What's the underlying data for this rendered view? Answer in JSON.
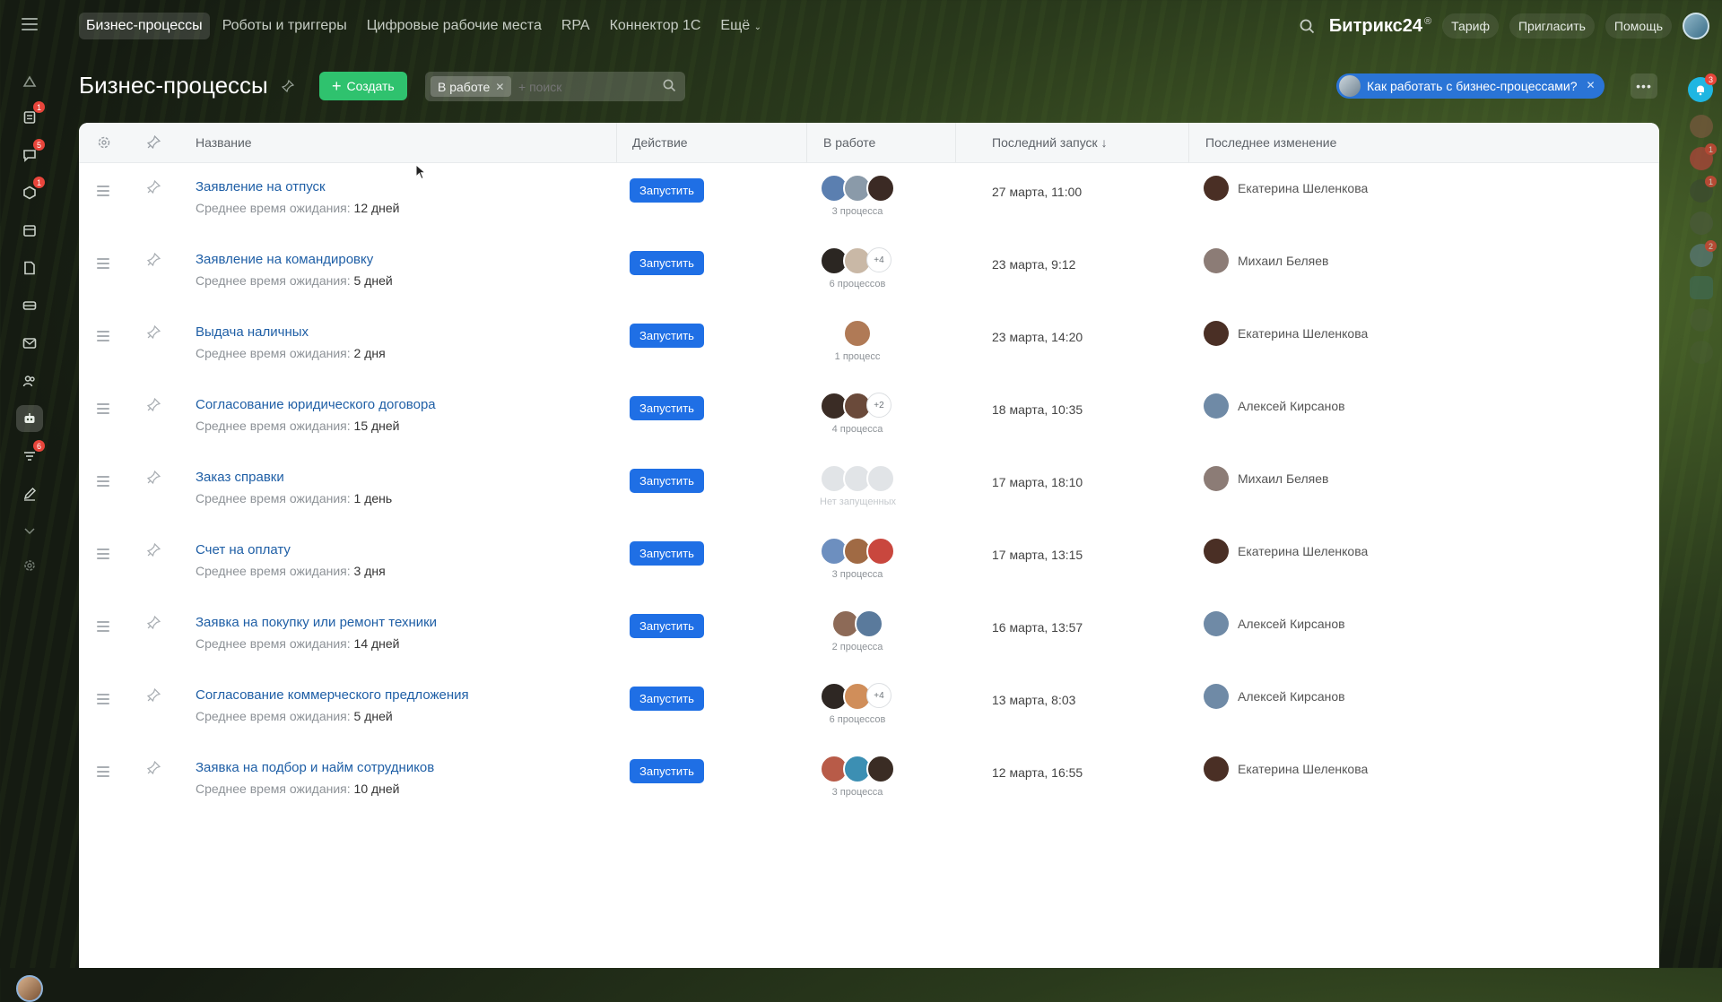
{
  "topnav": {
    "items": [
      "Бизнес-процессы",
      "Роботы и триггеры",
      "Цифровые рабочие места",
      "RPA",
      "Коннектор 1С",
      "Ещё"
    ],
    "brand": "Битрикс24",
    "brand_mark": "®",
    "tariff": "Тариф",
    "invite": "Пригласить",
    "help": "Помощь"
  },
  "leftbar": {
    "badges": [
      "1",
      "5",
      "1",
      "6"
    ]
  },
  "page": {
    "title": "Бизнес-процессы",
    "create_label": "Создать",
    "filter_chip": "В работе",
    "search_placeholder": "+ поиск",
    "help_link": "Как работать с бизнес-процессами?",
    "more_label": "•••"
  },
  "rightrail": {
    "bell_badge": "3",
    "badges": [
      "1",
      "1",
      "2"
    ]
  },
  "table": {
    "columns": {
      "name": "Название",
      "action": "Действие",
      "in_work": "В работе",
      "last_run": "Последний запуск ↓",
      "last_change": "Последнее изменение"
    },
    "meta_prefix": "Среднее время ожидания:",
    "run_label": "Запустить",
    "rows": [
      {
        "name": "Заявление на отпуск",
        "wait": "12 дней",
        "procs": "3 процесса",
        "last_run": "27 марта, 11:00",
        "changed_by": "Екатерина Шеленкова"
      },
      {
        "name": "Заявление на командировку",
        "wait": "5 дней",
        "procs": "6 процессов",
        "plus": "+4",
        "last_run": "23 марта, 9:12",
        "changed_by": "Михаил Беляев"
      },
      {
        "name": "Выдача наличных",
        "wait": "2 дня",
        "procs": "1 процесс",
        "last_run": "23 марта, 14:20",
        "changed_by": "Екатерина Шеленкова"
      },
      {
        "name": "Согласование юридического договора",
        "wait": "15 дней",
        "procs": "4 процесса",
        "plus": "+2",
        "last_run": "18 марта, 10:35",
        "changed_by": "Алексей Кирсанов"
      },
      {
        "name": "Заказ справки",
        "wait": "1 день",
        "procs": "Нет запущенных",
        "last_run": "17 марта, 18:10",
        "changed_by": "Михаил Беляев"
      },
      {
        "name": "Счет на оплату",
        "wait": "3 дня",
        "procs": "3 процесса",
        "last_run": "17 марта, 13:15",
        "changed_by": "Екатерина Шеленкова"
      },
      {
        "name": "Заявка на покупку или ремонт техники",
        "wait": "14 дней",
        "procs": "2 процесса",
        "last_run": "16 марта, 13:57",
        "changed_by": "Алексей Кирсанов"
      },
      {
        "name": "Согласование коммерческого предложения",
        "wait": "5 дней",
        "procs": "6 процессов",
        "plus": "+4",
        "last_run": "13 марта, 8:03",
        "changed_by": "Алексей Кирсанов"
      },
      {
        "name": "Заявка на подбор и найм сотрудников",
        "wait": "10 дней",
        "procs": "3 процесса",
        "last_run": "12 марта, 16:55",
        "changed_by": "Екатерина Шеленкова"
      }
    ]
  },
  "colors": {
    "accent_blue": "#1f6fe5",
    "create_green": "#2fc26e",
    "link_blue": "#1f5fa6",
    "badge_red": "#e8453b"
  }
}
